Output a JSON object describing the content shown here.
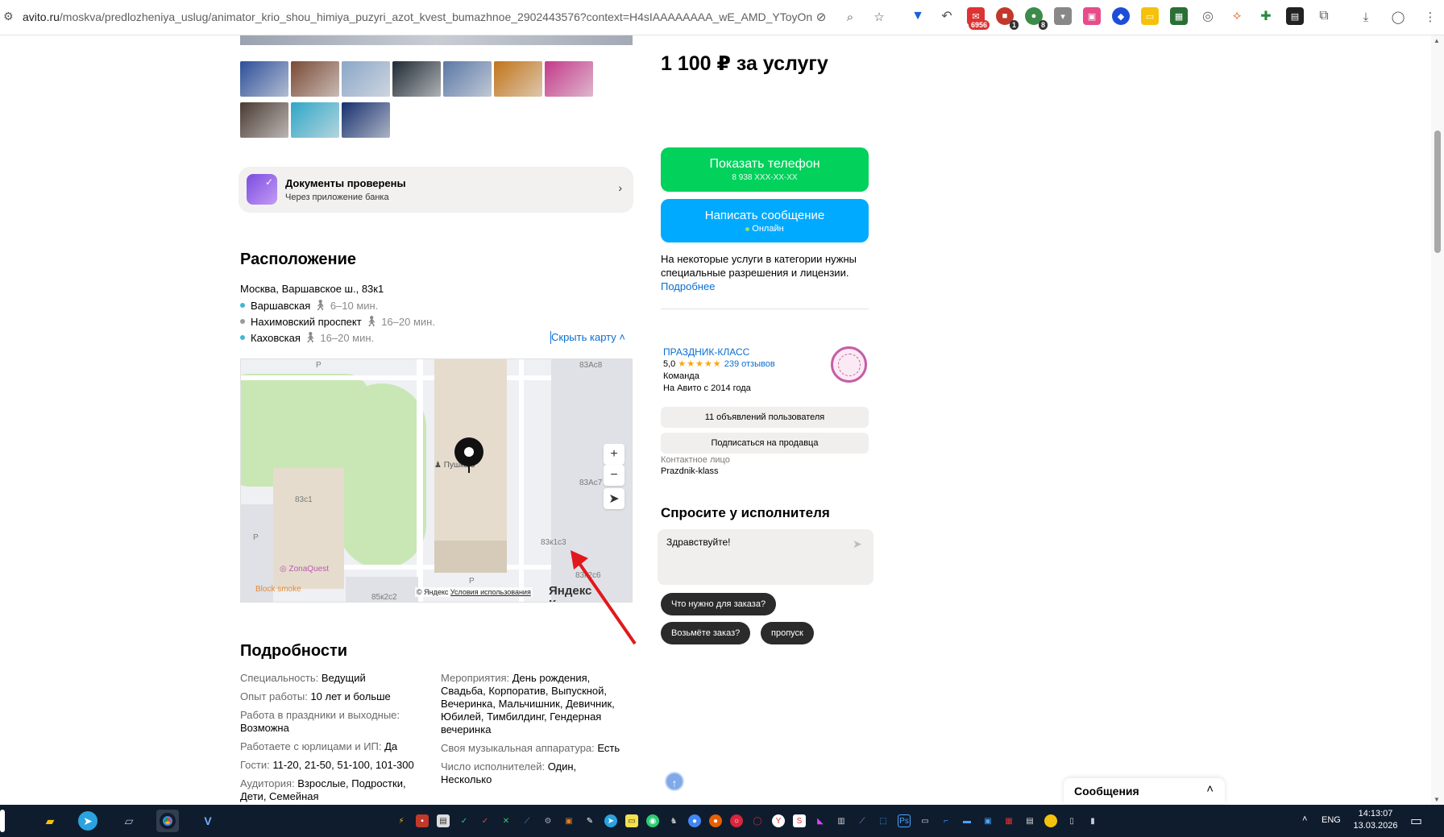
{
  "browser": {
    "url_domain": "avito.ru",
    "url_path": "/moskva/predlozheniya_uslug/animator_krio_shou_himiya_puzyri_azot_kvest_bumazhnoe_2902443576?context=H4sIAAAAAAAA_wE_AMD_YToyOntz...",
    "ext_badges": {
      "mail": "6956",
      "adblock": "1",
      "ext3": "8"
    }
  },
  "docs": {
    "title": "Документы проверены",
    "subtitle": "Через приложение банка"
  },
  "location": {
    "heading": "Расположение",
    "address": "Москва, Варшавское ш., 83к1",
    "metro": [
      {
        "name": "Варшавская",
        "time": "6–10 мин.",
        "color": "#3fb6d9"
      },
      {
        "name": "Нахимовский проспект",
        "time": "16–20 мин.",
        "color": "#9a9a9a"
      },
      {
        "name": "Каховская",
        "time": "16–20 мин.",
        "color": "#3fb6d9"
      }
    ],
    "hide_map": "Скрыть карту"
  },
  "map": {
    "labels": [
      "83Ас8",
      "83Ас7",
      "83с1",
      "83к1с3",
      "83к2с6",
      "85к2с2",
      "Р",
      "Р",
      "Р",
      "Пушка 3",
      "ZonaQuest",
      "Block smoke"
    ],
    "copyright": "© Яндекс",
    "terms": "Условия использования",
    "logo": "Яндекс Карты"
  },
  "details": {
    "heading": "Подробности",
    "left": [
      {
        "k": "Специальность:",
        "v": "Ведущий"
      },
      {
        "k": "Опыт работы:",
        "v": "10 лет и больше"
      },
      {
        "k": "Работа в праздники и выходные:",
        "v": "Возможна"
      },
      {
        "k": "Работаете с юрлицами и ИП:",
        "v": "Да"
      },
      {
        "k": "Гости:",
        "v": "11-20, 21-50, 51-100, 101-300"
      },
      {
        "k": "Аудитория:",
        "v": "Взрослые, Подростки, Дети, Семейная"
      }
    ],
    "right": [
      {
        "k": "Мероприятия:",
        "v": "День рождения, Свадьба, Корпоратив, Выпускной, Вечеринка, Мальчишник, Девичник, Юбилей, Тимбилдинг, Гендерная вечеринка"
      },
      {
        "k": "Своя музыкальная аппаратура:",
        "v": "Есть"
      },
      {
        "k": "Число исполнителей:",
        "v": "Один, Несколько"
      }
    ]
  },
  "sidebar": {
    "price": "1 100 ₽ за услугу",
    "phone_btn": "Показать телефон",
    "phone_masked": "8 938 XXX-XX-XX",
    "msg_btn": "Написать сообщение",
    "online": "Онлайн",
    "notice": "На некоторые услуги в категории нужны специальные разрешения и лицензии.",
    "notice_more": "Подробнее",
    "seller_name": "ПРАЗДНИК-КЛАСС",
    "rating": "5,0",
    "stars": "★★★★★",
    "reviews": "239 отзывов",
    "seller_type": "Команда",
    "since": "На Авито с 2014 года",
    "ads_btn": "11 объявлений пользователя",
    "subscribe_btn": "Подписаться на продавца",
    "contact_label": "Контактное лицо",
    "contact_name": "Prazdnik-klass",
    "ask_title": "Спросите у исполнителя",
    "ask_value": "Здравствуйте!",
    "chips": [
      "Что нужно для заказа?",
      "Возьмёте заказ?",
      "пропуск"
    ]
  },
  "messages_tab": "Сообщения",
  "taskbar": {
    "lang": "ENG",
    "time": "14:13:07",
    "date": "13.03.2026"
  },
  "thumb_colors": [
    "#2d4f9a",
    "#7a4a35",
    "#8aa7c8",
    "#1f2a34",
    "#5b78a6",
    "#c2741a",
    "#c43a8a",
    "#4a3a32",
    "#2fa6c7",
    "#17306e"
  ]
}
